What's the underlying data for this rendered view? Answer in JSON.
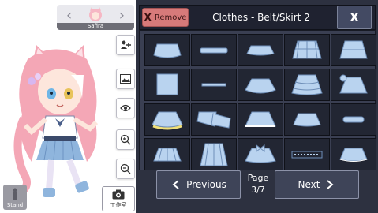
{
  "character": {
    "name": "Safira",
    "prev_arrow": "‹",
    "next_arrow": "›"
  },
  "side_tools": [
    {
      "icon": "add-person-icon"
    },
    {
      "icon": "image-icon"
    },
    {
      "icon": "eye-icon"
    },
    {
      "icon": "zoom-in-icon"
    },
    {
      "icon": "zoom-out-icon"
    }
  ],
  "bottom_left": {
    "stand_label": "Stand",
    "studio_label": "工作室"
  },
  "panel": {
    "remove_label": "Remove",
    "remove_icon": "X",
    "title": "Clothes - Belt/Skirt 2",
    "close_icon": "X"
  },
  "items": [
    {
      "name": "ruffle-skirt"
    },
    {
      "name": "plain-belt"
    },
    {
      "name": "short-skirt"
    },
    {
      "name": "plaid-skirt"
    },
    {
      "name": "tiered-skirt"
    },
    {
      "name": "straight-skirt"
    },
    {
      "name": "thin-belt"
    },
    {
      "name": "flared-skirt"
    },
    {
      "name": "layered-ruffle-skirt"
    },
    {
      "name": "bow-skirt"
    },
    {
      "name": "frilly-yellow-skirt"
    },
    {
      "name": "belt-with-buckle"
    },
    {
      "name": "lace-skirt"
    },
    {
      "name": "scallop-skirt"
    },
    {
      "name": "small-belt"
    },
    {
      "name": "pleated-skirt"
    },
    {
      "name": "long-pleated-skirt"
    },
    {
      "name": "bow-tutu-skirt"
    },
    {
      "name": "patterned-belt"
    },
    {
      "name": "frilled-mini-skirt"
    }
  ],
  "pager": {
    "previous_label": "Previous",
    "next_label": "Next",
    "page_label": "Page",
    "page_value": "3/7"
  },
  "colors": {
    "panel_bg": "#2d3140",
    "cell_bg": "#222633",
    "item_fill": "#b9d3ef",
    "remove_bg": "#d77a7a"
  }
}
